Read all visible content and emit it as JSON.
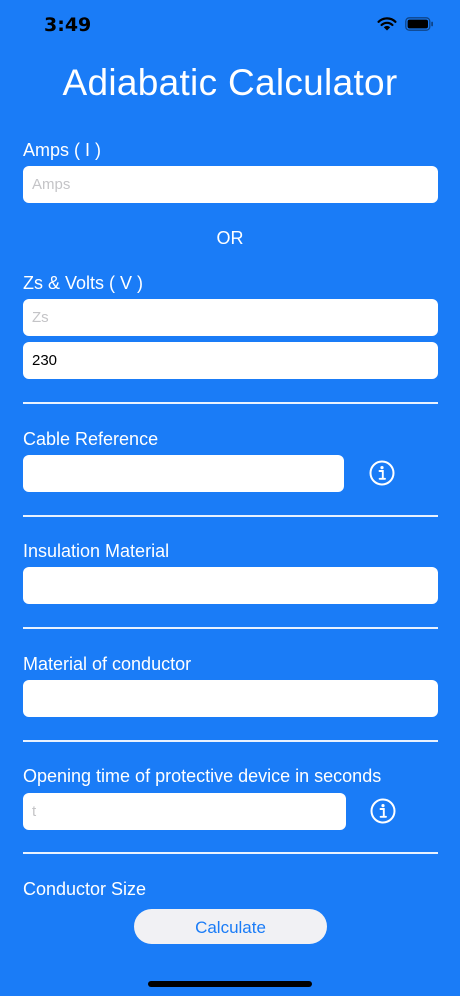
{
  "status_bar": {
    "time": "3:49"
  },
  "app": {
    "title": "Adiabatic Calculator"
  },
  "amps": {
    "label": "Amps ( I )",
    "placeholder": "Amps",
    "value": ""
  },
  "or_text": "OR",
  "zs_volts": {
    "label": "Zs & Volts ( V )",
    "zs_placeholder": "Zs",
    "zs_value": "",
    "volts_value": "230"
  },
  "cable_reference": {
    "label": "Cable Reference",
    "value": ""
  },
  "insulation_material": {
    "label": "Insulation Material",
    "value": ""
  },
  "conductor_material": {
    "label": "Material of conductor",
    "value": ""
  },
  "opening_time": {
    "label": "Opening time of protective device in seconds",
    "placeholder": "t",
    "value": ""
  },
  "conductor_size": {
    "label": "Conductor Size"
  },
  "actions": {
    "calculate_label": "Calculate"
  },
  "colors": {
    "background": "#1a7cf7",
    "field": "#ffffff",
    "button": "#f1f1f4",
    "accent": "#1a7cf7"
  },
  "icons": [
    "wifi-icon",
    "battery-icon",
    "info-icon"
  ]
}
